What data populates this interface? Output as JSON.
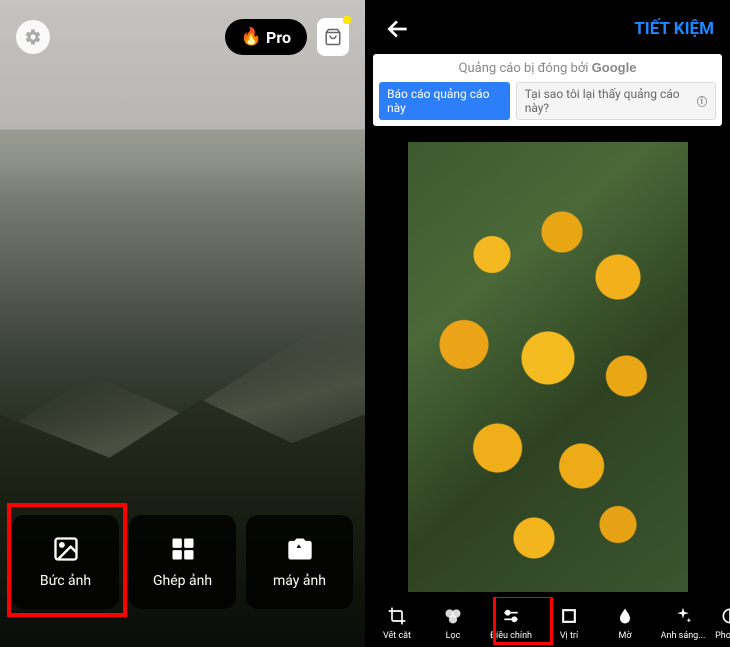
{
  "left": {
    "pro_label": "Pro",
    "cards": [
      {
        "label": "Bức ảnh"
      },
      {
        "label": "Ghép ảnh"
      },
      {
        "label": "máy ảnh"
      }
    ]
  },
  "right": {
    "save_label": "TIẾT KIỆM",
    "ad": {
      "closed_prefix": "Quảng cáo bị đóng bởi ",
      "google": "Google",
      "report_btn": "Báo cáo quảng cáo này",
      "why_btn": "Tại sao tôi lại thấy quảng cáo này?"
    },
    "tools": [
      {
        "label": "Vết cắt"
      },
      {
        "label": "Lọc"
      },
      {
        "label": "Điều chỉnh"
      },
      {
        "label": "Vị trí"
      },
      {
        "label": "Mờ"
      },
      {
        "label": "Ánh sáng..."
      },
      {
        "label": "Phơi sá"
      }
    ]
  }
}
